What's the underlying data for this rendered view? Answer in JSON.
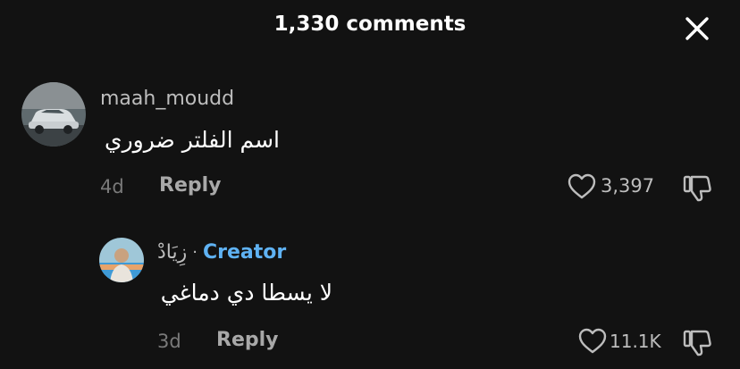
{
  "header": {
    "title": "1,330 comments",
    "close_icon": "close-icon"
  },
  "comments": [
    {
      "username": "maah_moudd",
      "text": "اسم الفلتر ضروري",
      "time": "4d",
      "reply_label": "Reply",
      "likes": "3,397",
      "avatar_icon": "car-avatar"
    }
  ],
  "replies": [
    {
      "username": "زِيَادْ",
      "separator": "·",
      "badge": "Creator",
      "text": "لا يسطا دي دماغي",
      "time": "3d",
      "reply_label": "Reply",
      "likes": "11.1K",
      "avatar_icon": "person-avatar"
    }
  ],
  "colors": {
    "background": "#121212",
    "creator_badge": "#5fb2f3",
    "muted_text": "#7a7a7a"
  }
}
